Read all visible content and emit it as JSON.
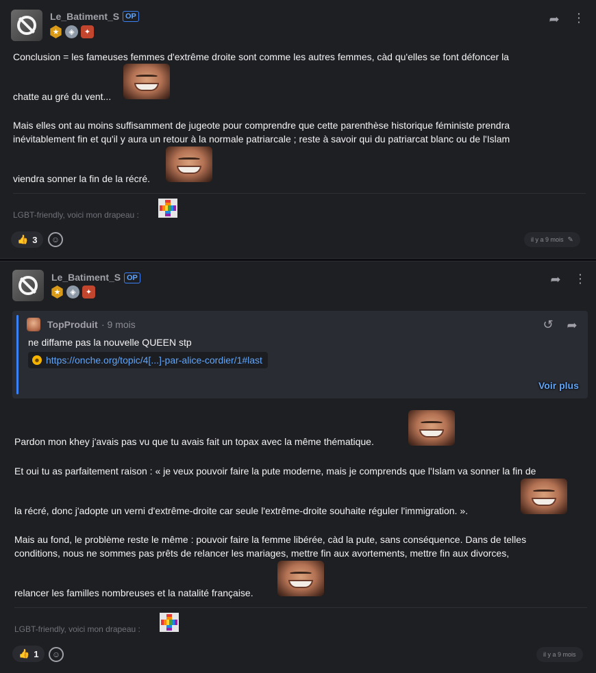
{
  "posts": [
    {
      "username": "Le_Batiment_S",
      "op": "OP",
      "lines": [
        "Conclusion = les fameuses femmes d'extrême droite sont comme les autres femmes, càd qu'elles se font défoncer la",
        "chatte au gré du vent...",
        "Mais elles ont au moins suffisamment de jugeote pour comprendre que cette parenthèse historique féministe prendra",
        "inévitablement fin et qu'il y aura un retour à la normale patriarcale ; reste à savoir qui du patriarcat blanc ou de l'Islam",
        "viendra sonner la fin de la récré."
      ],
      "signature": "LGBT-friendly, voici mon drapeau :",
      "likes": "3",
      "time": "il y a 9 mois"
    },
    {
      "username": "Le_Batiment_S",
      "op": "OP",
      "quote": {
        "user": "TopProduit",
        "time": "· 9 mois",
        "text": "ne diffame pas la nouvelle QUEEN stp",
        "link": "https://onche.org/topic/4[...]-par-alice-cordier/1#last",
        "more": "Voir plus"
      },
      "lines": [
        "Pardon mon khey j'avais pas vu que tu avais fait un topax avec la même thématique.",
        "Et oui tu as parfaitement raison : « je veux pouvoir faire la pute moderne, mais je comprends que l'Islam va sonner la fin de",
        "la récré, donc j'adopte un verni d'extrême-droite car seule l'extrême-droite souhaite réguler l'immigration. ».",
        "Mais au fond, le problème reste le même : pouvoir faire la femme libérée, càd la pute, sans conséquence. Dans de telles",
        "conditions, nous ne sommes pas prêts de relancer les mariages, mettre fin aux avortements, mettre fin aux divorces,",
        "relancer les familles nombreuses et la natalité française."
      ],
      "signature": "LGBT-friendly, voici mon drapeau :",
      "likes": "1",
      "time": "il y a 9 mois"
    }
  ]
}
